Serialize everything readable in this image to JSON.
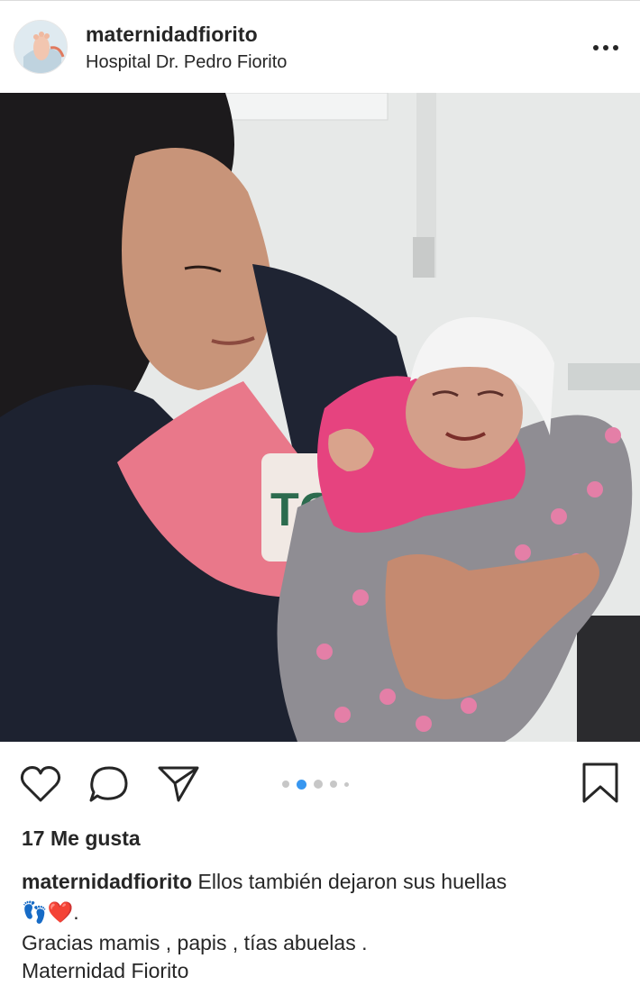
{
  "post": {
    "username": "maternidadfiorito",
    "location": "Hospital Dr. Pedro Fiorito",
    "likes_text": "17 Me gusta",
    "caption_username": "maternidadfiorito",
    "caption_text": "Ellos también dejaron sus huellas",
    "caption_emoji_line": "👣❤️.",
    "caption_line2": "Gracias mamis , papis , tías abuelas .",
    "caption_line3_partial": "Maternidad Fiorito"
  },
  "carousel": {
    "total": 5,
    "active_index": 1
  },
  "icons": {
    "more": "more-options-icon",
    "like": "heart-icon",
    "comment": "comment-bubble-icon",
    "share": "paper-plane-icon",
    "save": "bookmark-icon"
  },
  "colors": {
    "text": "#262626",
    "active_dot": "#3897f0",
    "inactive_dot": "#c7c7c7"
  }
}
